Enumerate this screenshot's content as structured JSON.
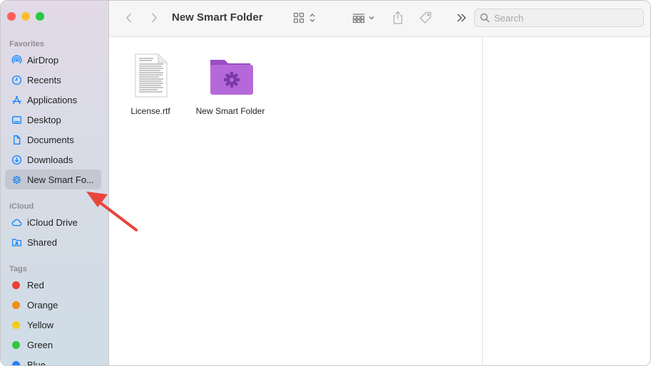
{
  "window": {
    "title": "New Smart Folder"
  },
  "colors": {
    "close": "#fe5f57",
    "minimize": "#febc2e",
    "zoom": "#28c840",
    "accent": "#0a84ff",
    "folder": "#b569d9",
    "arrow": "#e8453c"
  },
  "sidebar": {
    "favorites_title": "Favorites",
    "favorites": [
      {
        "label": "AirDrop",
        "icon": "airdrop-icon"
      },
      {
        "label": "Recents",
        "icon": "clock-icon"
      },
      {
        "label": "Applications",
        "icon": "applications-icon"
      },
      {
        "label": "Desktop",
        "icon": "desktop-icon"
      },
      {
        "label": "Documents",
        "icon": "document-icon"
      },
      {
        "label": "Downloads",
        "icon": "download-icon"
      },
      {
        "label": "New Smart Fo...",
        "icon": "gear-icon",
        "selected": true
      }
    ],
    "icloud_title": "iCloud",
    "icloud": [
      {
        "label": "iCloud Drive",
        "icon": "cloud-icon"
      },
      {
        "label": "Shared",
        "icon": "shared-folder-icon"
      }
    ],
    "tags_title": "Tags",
    "tags": [
      {
        "label": "Red",
        "color": "#ec3f3a"
      },
      {
        "label": "Orange",
        "color": "#f0900f"
      },
      {
        "label": "Yellow",
        "color": "#f5cb1a"
      },
      {
        "label": "Green",
        "color": "#33c640"
      },
      {
        "label": "Blue",
        "color": "#2d7ef7"
      }
    ]
  },
  "toolbar": {
    "search_placeholder": "Search"
  },
  "files": [
    {
      "name": "License.rtf",
      "icon": "rtf-document-icon"
    },
    {
      "name": "New Smart Folder",
      "icon": "smart-folder-icon"
    }
  ]
}
